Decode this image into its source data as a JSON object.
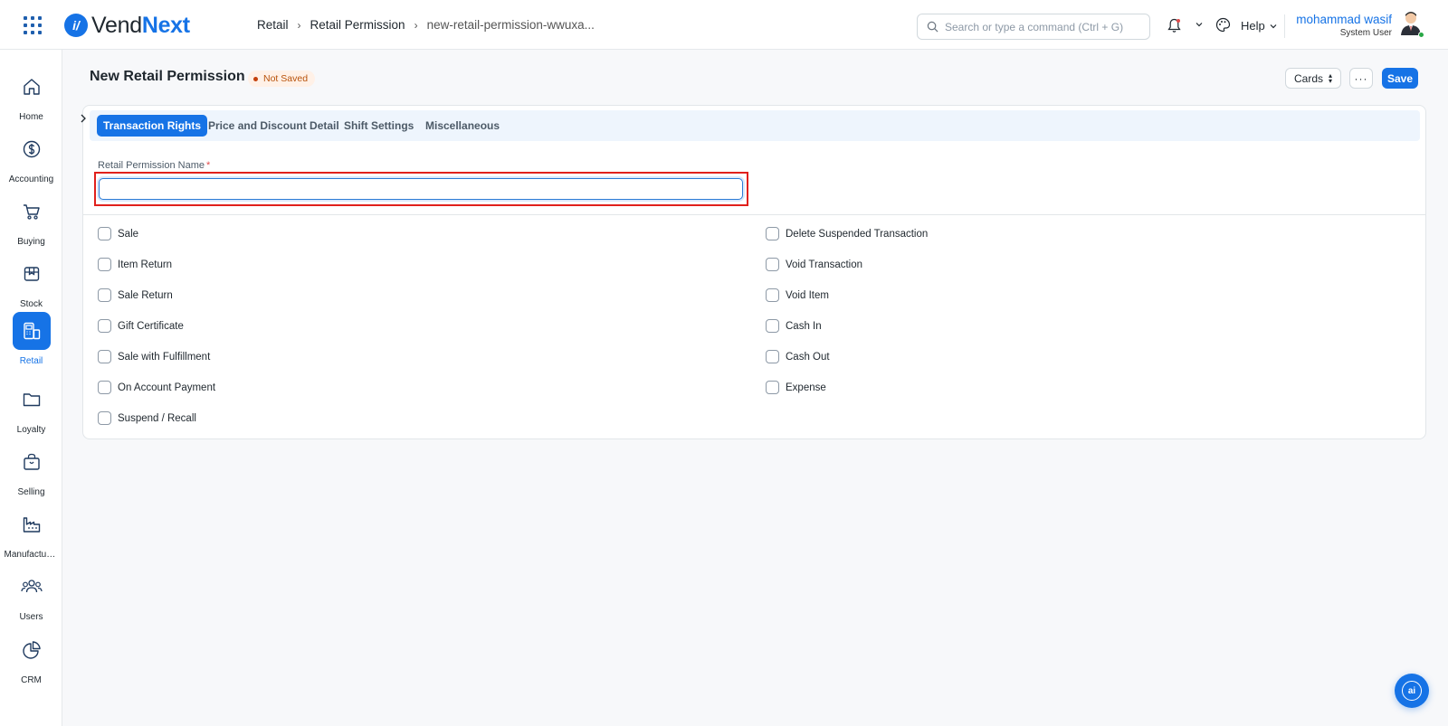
{
  "app": {
    "logo_prefix": "i",
    "logo_mid": "Vend",
    "logo_suffix": "Next",
    "logo_mark": "i/"
  },
  "breadcrumbs": [
    "Retail",
    "Retail Permission",
    "new-retail-permission-wwuxa..."
  ],
  "search": {
    "placeholder": "Search or type a command (Ctrl + G)"
  },
  "header": {
    "help_label": "Help",
    "user_name": "mohammad wasif",
    "user_role": "System User"
  },
  "sidebar": {
    "items": [
      {
        "label": "Home",
        "icon": "home-icon"
      },
      {
        "label": "Accounting",
        "icon": "dollar-icon"
      },
      {
        "label": "Buying",
        "icon": "cart-icon"
      },
      {
        "label": "Stock",
        "icon": "box-icon"
      },
      {
        "label": "Retail",
        "icon": "pos-icon",
        "active": true
      },
      {
        "label": "Loyalty",
        "icon": "folder-icon"
      },
      {
        "label": "Selling",
        "icon": "shopping-bag-icon"
      },
      {
        "label": "Manufacturing",
        "icon": "factory-icon"
      },
      {
        "label": "Users",
        "icon": "users-icon"
      },
      {
        "label": "CRM",
        "icon": "pie-chart-icon"
      }
    ]
  },
  "page": {
    "title": "New Retail Permission",
    "status": "Not Saved",
    "view_label": "Cards",
    "more_label": "···",
    "save_label": "Save"
  },
  "tabs": [
    "Transaction Rights",
    "Price and Discount Detail",
    "Shift Settings",
    "Miscellaneous"
  ],
  "form": {
    "name_label": "Retail Permission Name",
    "required_mark": "*",
    "name_value": ""
  },
  "checks_left": [
    "Sale",
    "Item Return",
    "Sale Return",
    "Gift Certificate",
    "Sale with Fulfillment",
    "On Account Payment",
    "Suspend / Recall"
  ],
  "checks_right": [
    "Delete Suspended Transaction",
    "Void Transaction",
    "Void Item",
    "Cash In",
    "Cash Out",
    "Expense"
  ],
  "assistant": {
    "label": "ai"
  },
  "colors": {
    "accent": "#1673e6",
    "highlight": "#e0201c",
    "status_bg": "#fff1e7",
    "status_text": "#b8520a"
  }
}
